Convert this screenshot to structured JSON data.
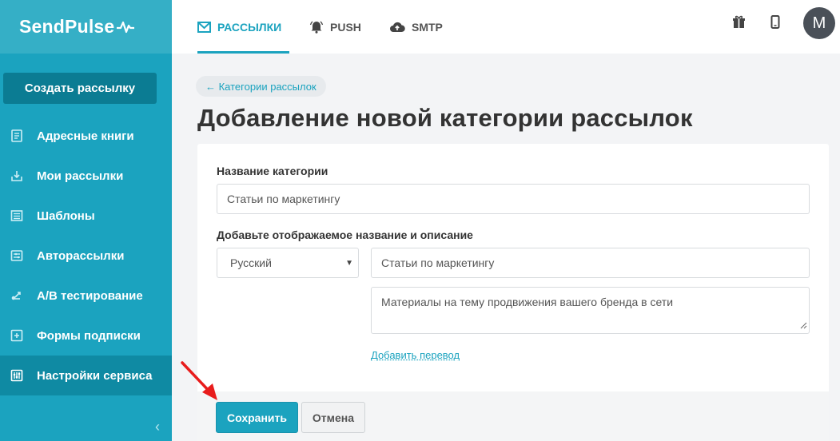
{
  "brand": {
    "name": "SendPulse"
  },
  "colors": {
    "accent": "#1ba3bf",
    "sidebar": "#1ba3bf",
    "sidebar_dark": "#0b7c93",
    "annotation": "#e81c1c"
  },
  "sidebar": {
    "create_button": "Создать рассылку",
    "items": [
      {
        "label": "Адресные книги",
        "icon": "address-book-icon"
      },
      {
        "label": "Мои рассылки",
        "icon": "mailings-icon"
      },
      {
        "label": "Шаблоны",
        "icon": "templates-icon"
      },
      {
        "label": "Авторассылки",
        "icon": "automation-icon"
      },
      {
        "label": "A/B тестирование",
        "icon": "ab-test-icon"
      },
      {
        "label": "Формы подписки",
        "icon": "subscription-form-icon"
      },
      {
        "label": "Настройки сервиса",
        "icon": "settings-sliders-icon",
        "active": true
      }
    ]
  },
  "topbar": {
    "tabs": [
      {
        "label": "РАССЫЛКИ",
        "icon": "envelope-icon",
        "active": true
      },
      {
        "label": "PUSH",
        "icon": "bell-icon"
      },
      {
        "label": "SMTP",
        "icon": "cloud-upload-icon"
      }
    ],
    "avatar_letter": "M"
  },
  "page": {
    "back_link": "← Категории рассылок",
    "title": "Добавление новой категории рассылок"
  },
  "form": {
    "category_name_label": "Название категории",
    "category_name_value": "Статьи по маркетингу",
    "display_label": "Добавьте отображаемое название и описание",
    "language_selected": "Русский",
    "display_name_value": "Статьи по маркетингу",
    "description_value": "Материалы на тему продвижения вашего бренда в сети",
    "add_translation": "Добавить перевод",
    "save_label": "Сохранить",
    "cancel_label": "Отмена"
  }
}
